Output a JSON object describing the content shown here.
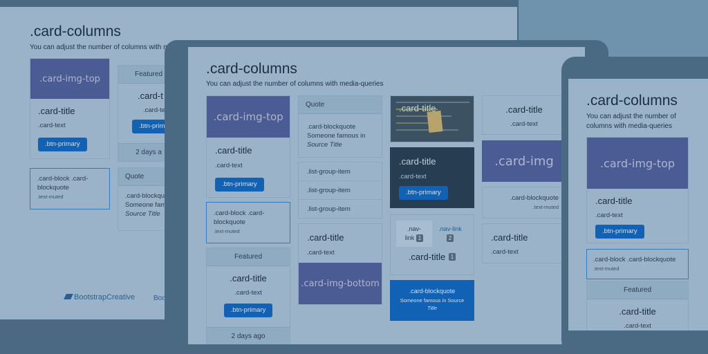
{
  "page": {
    "heading": ".card-columns",
    "lead": "You can adjust the number of columns with media-queries",
    "lead_monitor_visible": "You can adjust the number of columns with med",
    "phone_lead_1": "You can adjust the number of",
    "phone_lead_2": "columns with media-queries"
  },
  "cards": {
    "img_top": ".card-img-top",
    "img_bottom": ".card-img-bottom",
    "img": ".card-img",
    "title": ".card-title",
    "text": ".card-text",
    "btn": ".btn-primary",
    "featured": "Featured",
    "two_days": "2 days ago",
    "quote": "Quote",
    "bq_1": ".card-blockquote",
    "bq_2": "Someone famous in",
    "bq_source": "Source Title",
    "block_bq_1": ".card-block .card-",
    "block_bq_2": "blockquote",
    "block_bq_phone": ".card-block .card-blockquote",
    "text_muted": ".text-muted",
    "list_item": ".list-group-item",
    "nav_link": ".nav-link",
    "nav_link_split": "link",
    "nav_dot": ".nav-",
    "badge_1": "1",
    "badge_2": "2",
    "primary_bq_line2": "Someone famous in Source",
    "primary_bq_line3": "Title",
    "monitor_featured": "Featured",
    "monitor_title_cut": ".card-t",
    "monitor_text_cut": ".card-te",
    "monitor_btn_cut": ".btn-prim",
    "monitor_days_cut": "2 days a",
    "monitor_quote": "Quote",
    "monitor_bq_cut": ".card-blockqu",
    "monitor_famous_cut": "Someone fam",
    "monitor_source": "Source Title",
    "brand": "BootstrapCreative",
    "brand_cut": "Boo"
  },
  "colors": {
    "background": "#6f92ad",
    "screen": "#9ab3c8",
    "frame": "#4a6a84",
    "primary": "#1162b4",
    "image_block": "#4b5b93",
    "dark_card": "#263d52"
  }
}
